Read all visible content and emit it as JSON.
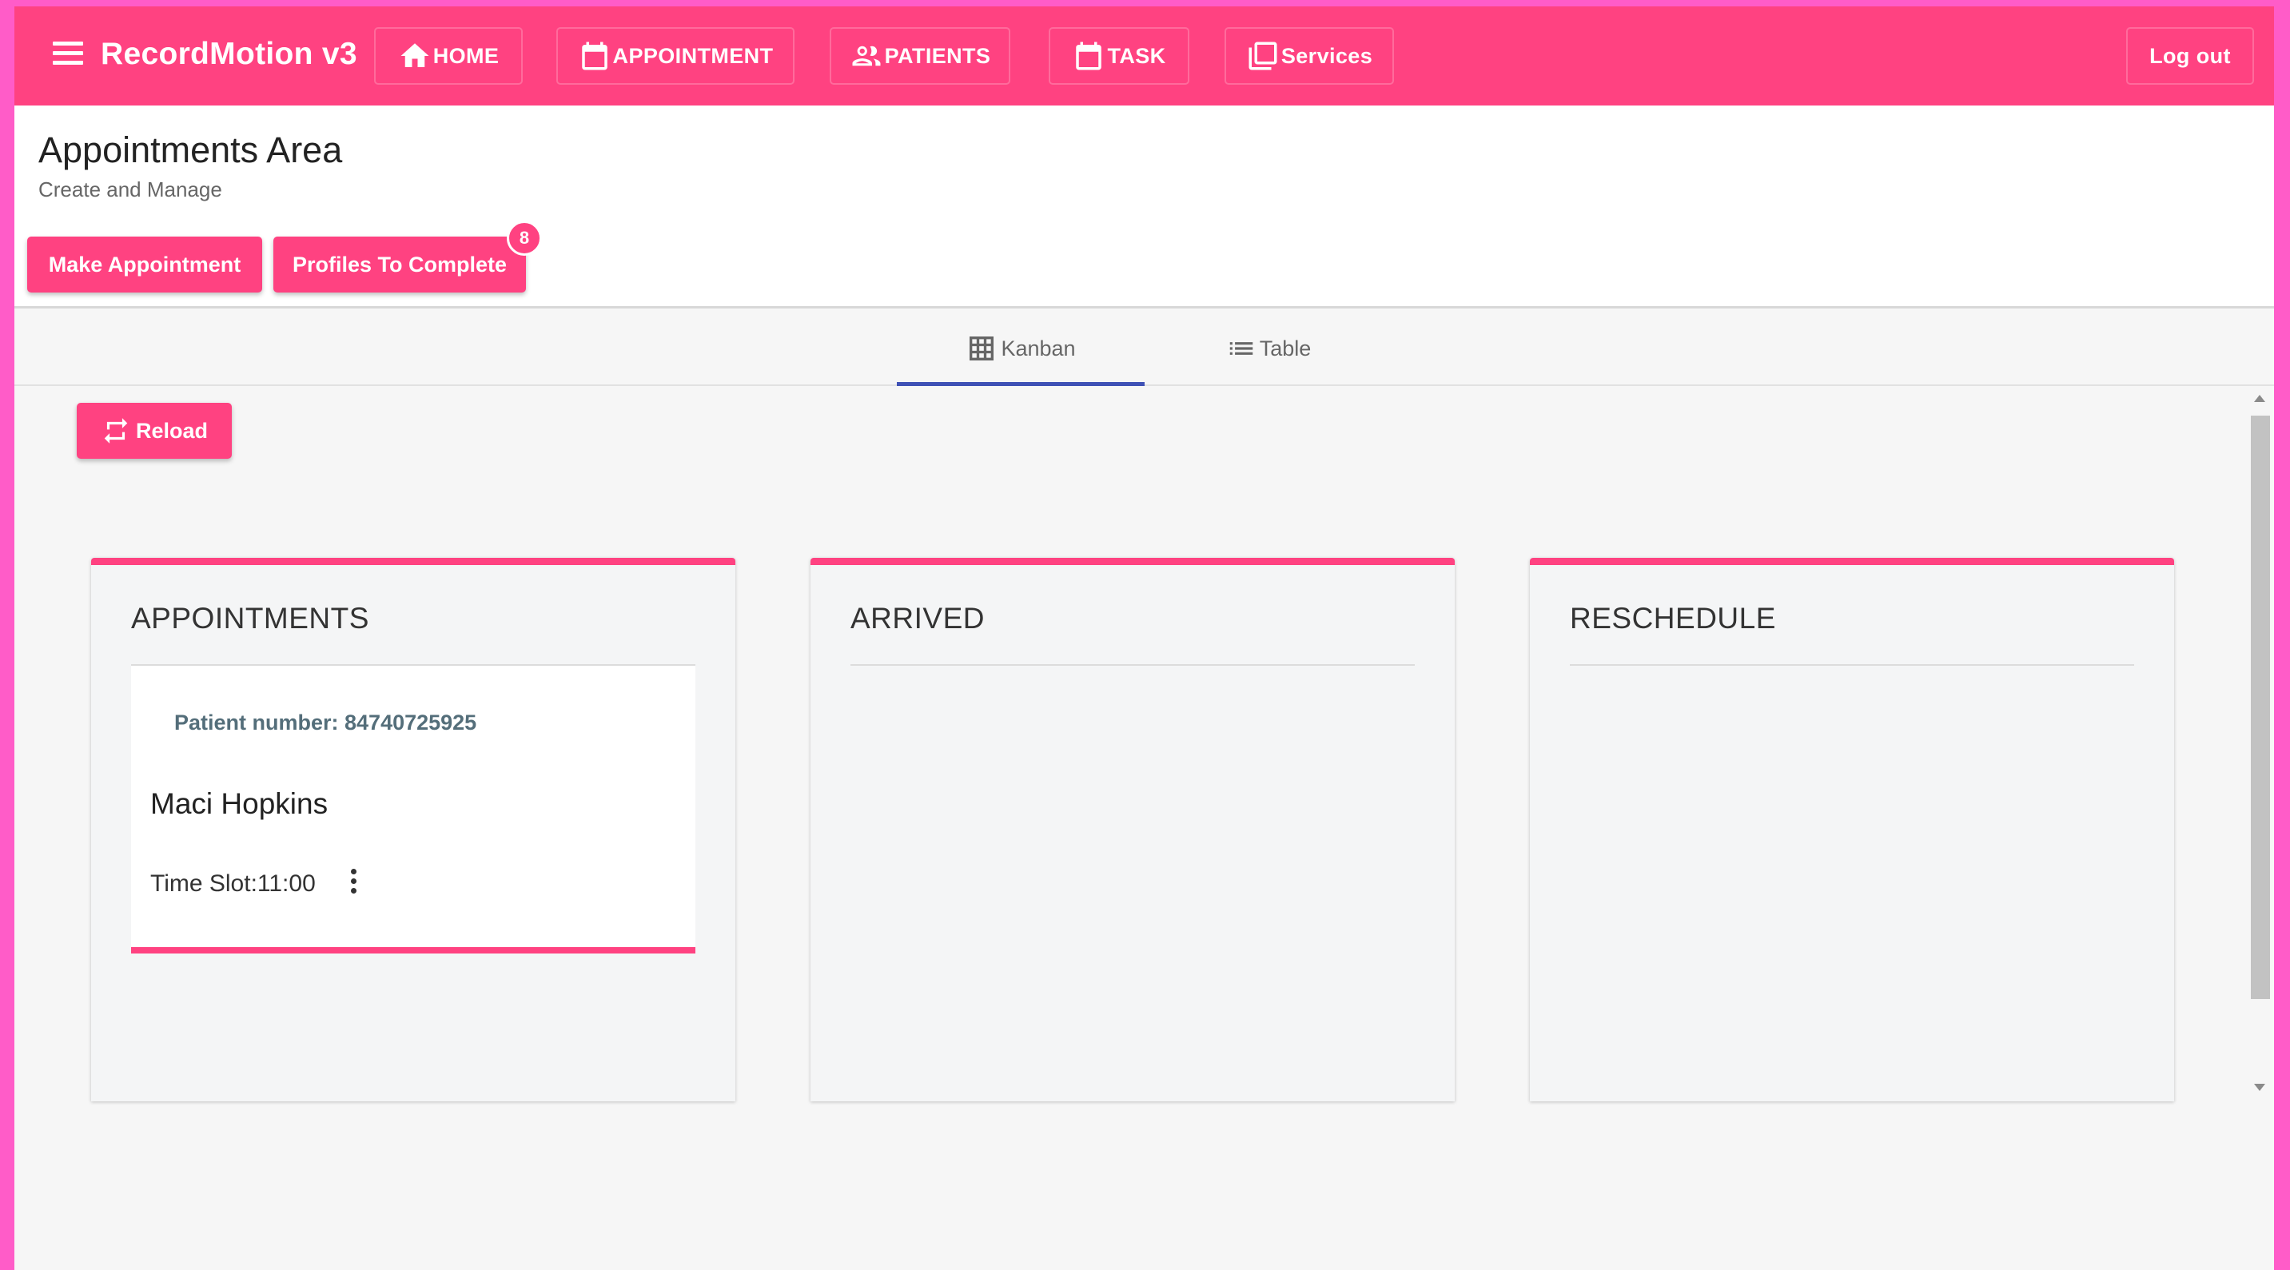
{
  "app": {
    "title": "RecordMotion v3",
    "colors": {
      "accent": "#ff4281",
      "frame": "#ff5cc8",
      "tab_ink": "#3f51b5",
      "card_label": "#546e7a"
    }
  },
  "nav": {
    "home": {
      "label": "HOME",
      "icon": "home-icon"
    },
    "appointment": {
      "label": "APPOINTMENT",
      "icon": "calendar-icon"
    },
    "patients": {
      "label": "PATIENTS",
      "icon": "people-icon"
    },
    "task": {
      "label": "TASK",
      "icon": "calendar-icon"
    },
    "services": {
      "label": "Services",
      "icon": "copy-icon"
    },
    "logout": {
      "label": "Log out"
    }
  },
  "header": {
    "title": "Appointments Area",
    "subtitle": "Create and Manage",
    "make_appointment": "Make Appointment",
    "profiles_to_complete": "Profiles To Complete",
    "profiles_badge": "8"
  },
  "tabs": [
    {
      "label": "Kanban",
      "icon": "grid-icon",
      "active": true
    },
    {
      "label": "Table",
      "icon": "list-icon",
      "active": false
    }
  ],
  "toolbar": {
    "reload": "Reload"
  },
  "kanban": {
    "columns": [
      {
        "title": "APPOINTMENTS",
        "cards": [
          {
            "patient_number": "Patient number: 84740725925",
            "name": "Maci Hopkins",
            "time_slot": "Time Slot:11:00"
          }
        ]
      },
      {
        "title": "ARRIVED",
        "cards": []
      },
      {
        "title": "RESCHEDULE",
        "cards": []
      }
    ]
  }
}
